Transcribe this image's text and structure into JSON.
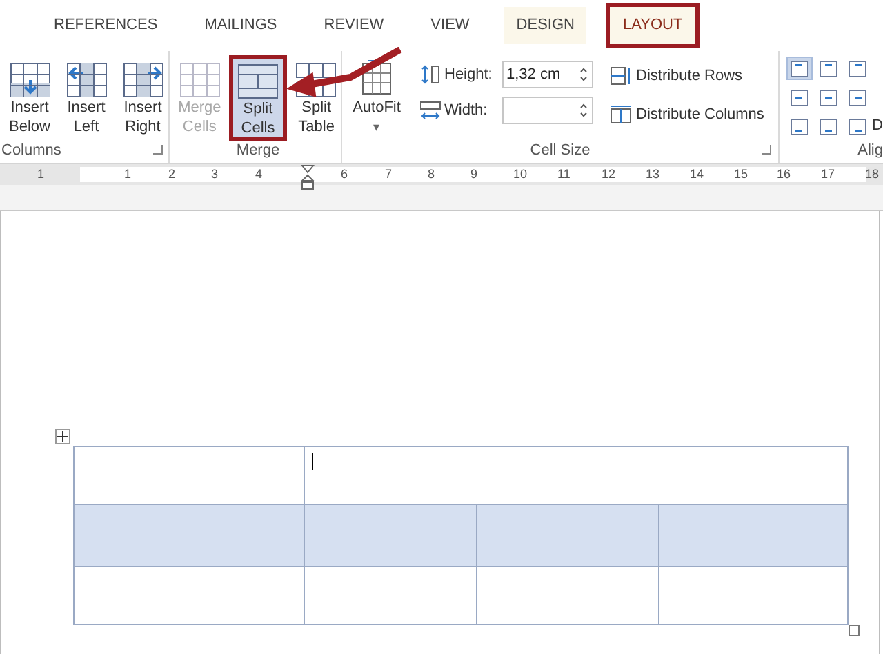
{
  "tabs": [
    {
      "label": "REFERENCES",
      "selected": false,
      "highlighted": false,
      "contextual": false
    },
    {
      "label": "MAILINGS",
      "selected": false,
      "highlighted": false,
      "contextual": false
    },
    {
      "label": "REVIEW",
      "selected": false,
      "highlighted": false,
      "contextual": false
    },
    {
      "label": "VIEW",
      "selected": false,
      "highlighted": false,
      "contextual": false
    },
    {
      "label": "DESIGN",
      "selected": false,
      "highlighted": false,
      "contextual": true
    },
    {
      "label": "LAYOUT",
      "selected": true,
      "highlighted": true,
      "contextual": true
    }
  ],
  "groups": [
    {
      "label": "Columns",
      "launcher": true,
      "buttons": [
        {
          "label": "Insert\nBelow",
          "disabled": false,
          "highlighted": false
        },
        {
          "label": "Insert\nLeft",
          "disabled": false,
          "highlighted": false
        },
        {
          "label": "Insert\nRight",
          "disabled": false,
          "highlighted": false
        }
      ]
    },
    {
      "label": "Merge",
      "launcher": false,
      "buttons": [
        {
          "label": "Merge\nCells",
          "disabled": true,
          "highlighted": false
        },
        {
          "label": "Split\nCells",
          "disabled": false,
          "highlighted": true
        },
        {
          "label": "Split\nTable",
          "disabled": false,
          "highlighted": false
        }
      ]
    }
  ],
  "cell_size": {
    "label": "Cell Size",
    "autofit": {
      "label": "AutoFit",
      "caret": "▾"
    },
    "height": {
      "label": "Height:",
      "value": "1,32 cm"
    },
    "width": {
      "label": "Width:"
    },
    "distribute": [
      "Distribute Rows",
      "Distribute Columns"
    ]
  },
  "alignment": {
    "label": "Alig",
    "cut_text": "D",
    "buttons": [
      {
        "selected": true
      },
      {
        "selected": false
      },
      {
        "selected": false
      },
      {
        "selected": false
      },
      {
        "selected": false
      },
      {
        "selected": false
      },
      {
        "selected": false
      },
      {
        "selected": false
      },
      {
        "selected": false
      }
    ]
  },
  "ruler": [
    "1",
    "1",
    "2",
    "3",
    "4",
    "6",
    "7",
    "8",
    "9",
    "10",
    "11",
    "12",
    "13",
    "14",
    "15",
    "16",
    "17",
    "18"
  ],
  "table": {
    "rows": [
      {
        "selected": false,
        "split": false,
        "caret": true
      },
      {
        "selected": true,
        "split": true,
        "caret": false
      },
      {
        "selected": false,
        "split": true,
        "caret": false
      }
    ]
  }
}
